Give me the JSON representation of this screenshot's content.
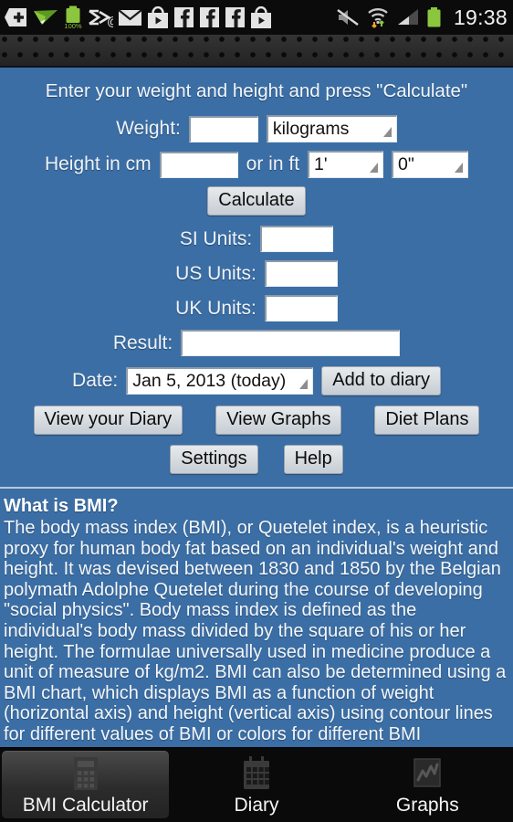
{
  "statusbar": {
    "clock": "19:38",
    "battery_percent": "100%",
    "left_icons": [
      "plus-badge-icon",
      "paper-plane-icon",
      "battery-percent-icon",
      "mail-at-icon",
      "gmail-icon",
      "play-store-icon",
      "facebook-icon-1",
      "facebook-icon-2",
      "facebook-icon-3",
      "play-store-icon-2"
    ],
    "right_icons": [
      "volume-muted-icon",
      "wifi-transfer-icon",
      "cellular-signal-icon",
      "battery-icon"
    ]
  },
  "form": {
    "headline": "Enter your weight and height and press \"Calculate\"",
    "weight_label": "Weight:",
    "weight_value": "",
    "weight_unit": "kilograms",
    "height_label": "Height in cm",
    "height_value": "",
    "height_or_label": "or in ft",
    "feet_value": "1'",
    "inches_value": "0\"",
    "calculate_label": "Calculate",
    "si_label": "SI Units:",
    "si_value": "",
    "us_label": "US Units:",
    "us_value": "",
    "uk_label": "UK Units:",
    "uk_value": "",
    "result_label": "Result:",
    "result_value": "",
    "date_label": "Date:",
    "date_value": "Jan 5, 2013 (today)",
    "add_to_diary_label": "Add to diary",
    "view_diary_label": "View your Diary",
    "view_graphs_label": "View Graphs",
    "diet_plans_label": "Diet Plans",
    "settings_label": "Settings",
    "help_label": "Help"
  },
  "article": {
    "title": "What is BMI?",
    "body": "The body mass index (BMI), or Quetelet index, is a heuristic proxy for human body fat based on an individual's weight and height. It was devised between 1830 and 1850 by the Belgian polymath Adolphe Quetelet during the course of developing \"social physics\". Body mass index is defined as the individual's body mass divided by the square of his or her height. The formulae universally used in medicine produce a unit of measure of kg/m2. BMI can also be determined using a BMI chart, which displays BMI as a function of weight (horizontal axis) and height (vertical axis) using contour lines for different values of BMI or colors for different BMI categories."
  },
  "tabs": [
    {
      "label": "BMI Calculator",
      "icon": "calculator-icon",
      "active": true
    },
    {
      "label": "Diary",
      "icon": "calendar-icon",
      "active": false
    },
    {
      "label": "Graphs",
      "icon": "line-chart-icon",
      "active": false
    }
  ],
  "colors": {
    "background_blue": "#3b6ea5",
    "statusbar_black": "#0b0b0b",
    "battery_green": "#8cc63e",
    "button_gray": "#d2d8de"
  }
}
